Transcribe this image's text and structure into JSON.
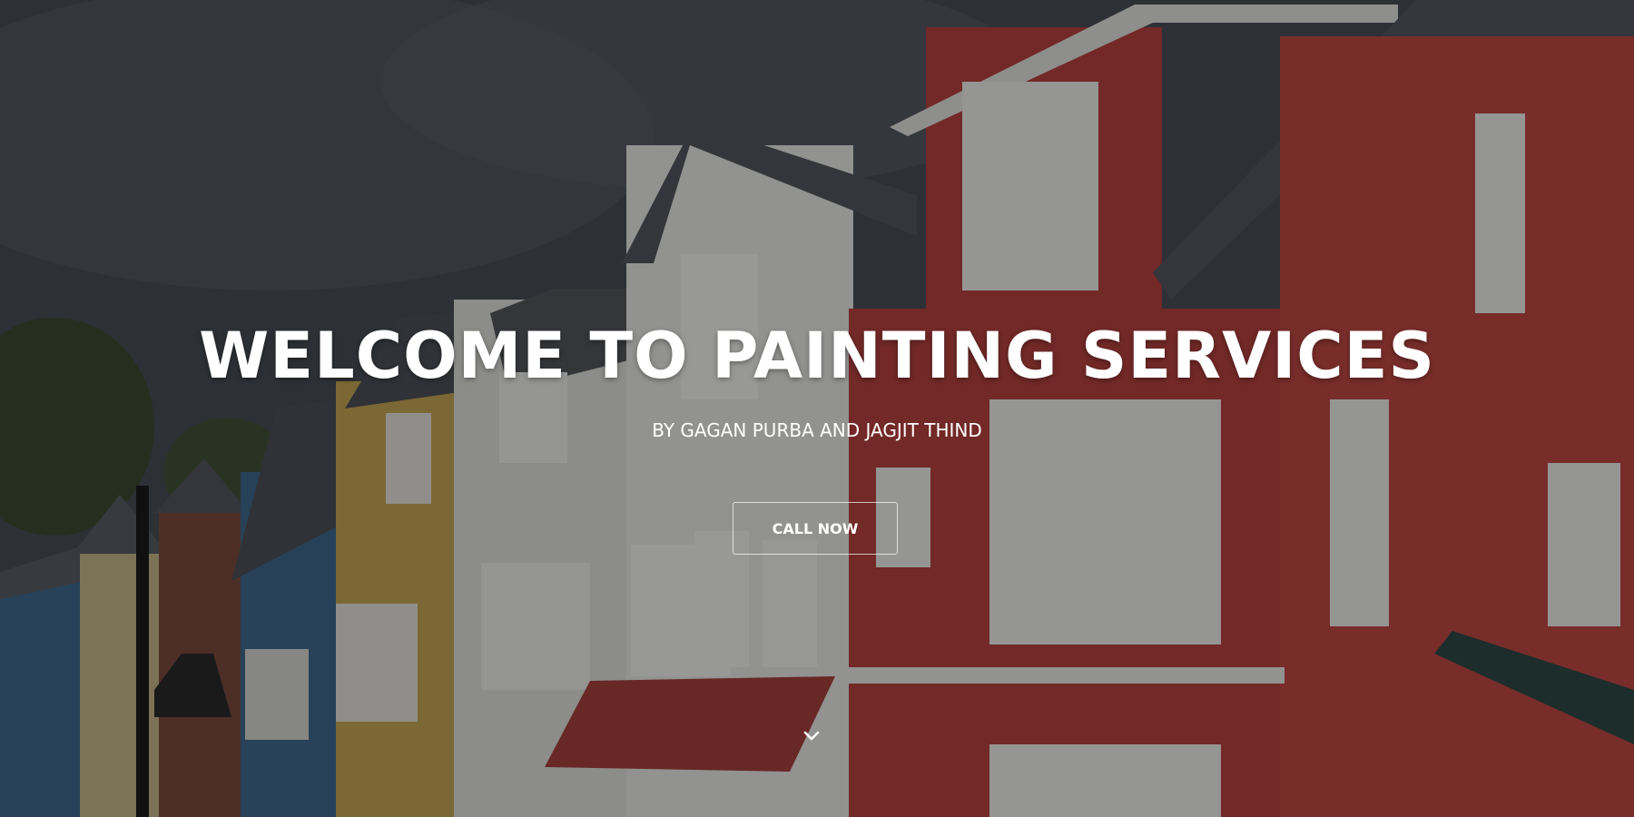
{
  "hero": {
    "title": "WELCOME TO PAINTING SERVICES",
    "subtitle": "BY GAGAN PURBA AND JAGJIT THIND",
    "cta_label": "CALL NOW",
    "scroll_icon": "chevron-down-icon",
    "background_image": "row of colorful townhouses with red, white, yellow and blue siding under a cloudy sky"
  },
  "colors": {
    "text": "#ffffff",
    "red_siding": "#b8433f",
    "white_siding": "#e6e6e2",
    "yellow_siding": "#c9a955",
    "blue_siding": "#3f6b8f",
    "roof": "#4b4f57"
  }
}
